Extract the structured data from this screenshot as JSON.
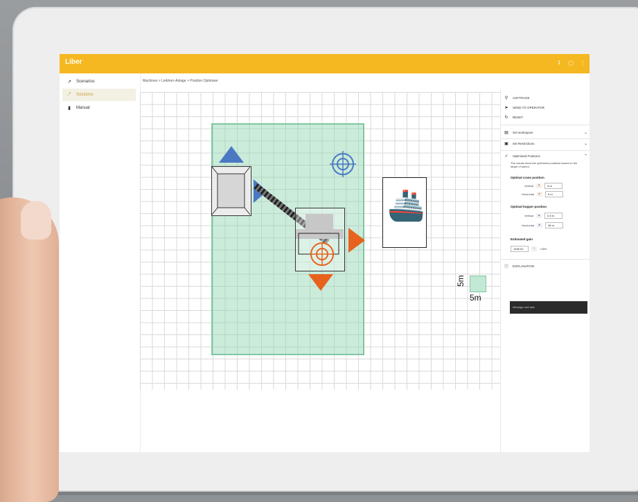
{
  "app": {
    "brand": "Liber",
    "brand_sub": ""
  },
  "appbar_icons": [
    "download-icon",
    "help-icon",
    "menu-icon"
  ],
  "sidebar": {
    "items": [
      {
        "label": "Scenarios",
        "icon": "chart-icon",
        "active": false
      },
      {
        "label": "Solutions",
        "icon": "crane-icon",
        "active": true
      },
      {
        "label": "Manual",
        "icon": "book-icon",
        "active": false
      }
    ]
  },
  "breadcrumb": "Machines > Liebherr-Anlage > Position Optimiser",
  "panel": {
    "top_actions": [
      {
        "label": "AUFTRAGE",
        "icon": "pin-icon"
      },
      {
        "label": "SEND TO OPERATOR",
        "icon": "send-icon"
      },
      {
        "label": "RESET",
        "icon": "reset-icon"
      }
    ],
    "sections": [
      {
        "label": "Set workspace",
        "icon": "workspace-icon"
      },
      {
        "label": "Set Restrictions",
        "icon": "lock-icon"
      },
      {
        "label": "Optimised Positions",
        "icon": "check-icon"
      }
    ],
    "description": "The results show the optimized positions based on the target of speed.",
    "crane_heading": "Optimal crane position",
    "crane_vertical": {
      "label": "Vertical",
      "value": "5 m"
    },
    "crane_horizontal": {
      "label": "Horizontal",
      "value": "5 m"
    },
    "hopper_heading": "Optimal hopper position",
    "hopper_vertical": {
      "label": "Vertical",
      "value": "0,5 m"
    },
    "hopper_horizontal": {
      "label": "Horizontal",
      "value": "38 m"
    },
    "gain_heading": "Estimated gain",
    "gain_value": "1458 t/h",
    "gain_delta": "+28%",
    "footer_label": "EXPLANATION",
    "button_label": "Message next task"
  },
  "canvas": {
    "scale_x": "5m",
    "scale_y": "5m",
    "colors": {
      "zone": "#8cd2af",
      "hopper_arrow": "#4a78c2",
      "crane_arrow": "#e8621d",
      "target": "#4a78c2"
    }
  }
}
